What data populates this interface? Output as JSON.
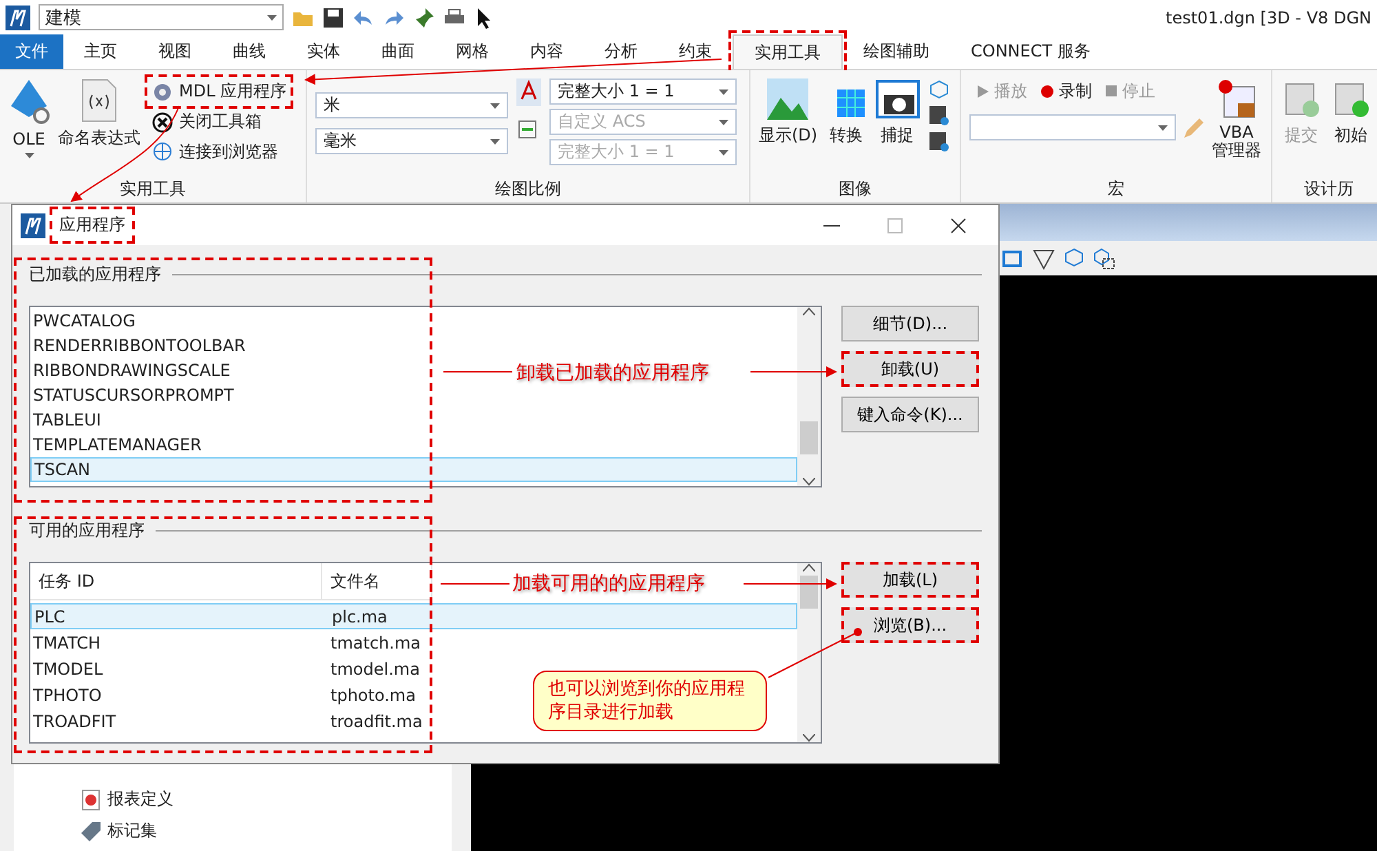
{
  "app": {
    "workflow": "建模",
    "title": "test01.dgn [3D - V8 DGN"
  },
  "menu_tabs": [
    {
      "label": "文件",
      "kind": "file",
      "selected": false,
      "highlighted": false
    },
    {
      "label": "主页",
      "kind": "tab",
      "selected": false,
      "highlighted": false
    },
    {
      "label": "视图",
      "kind": "tab",
      "selected": false,
      "highlighted": false
    },
    {
      "label": "曲线",
      "kind": "tab",
      "selected": false,
      "highlighted": false
    },
    {
      "label": "实体",
      "kind": "tab",
      "selected": false,
      "highlighted": false
    },
    {
      "label": "曲面",
      "kind": "tab",
      "selected": false,
      "highlighted": false
    },
    {
      "label": "网格",
      "kind": "tab",
      "selected": false,
      "highlighted": false
    },
    {
      "label": "内容",
      "kind": "tab",
      "selected": false,
      "highlighted": false
    },
    {
      "label": "分析",
      "kind": "tab",
      "selected": false,
      "highlighted": false
    },
    {
      "label": "约束",
      "kind": "tab",
      "selected": false,
      "highlighted": false
    },
    {
      "label": "实用工具",
      "kind": "tab",
      "selected": true,
      "highlighted": true
    },
    {
      "label": "绘图辅助",
      "kind": "tab",
      "selected": false,
      "highlighted": false
    },
    {
      "label": "CONNECT 服务",
      "kind": "tab",
      "selected": false,
      "highlighted": false
    }
  ],
  "ribbon": {
    "utility": {
      "label": "实用工具",
      "large": [
        "OLE",
        "命名表达式"
      ],
      "small": [
        {
          "label": "MDL 应用程序",
          "highlighted": true
        },
        {
          "label": "关闭工具箱",
          "highlighted": false
        },
        {
          "label": "连接到浏览器",
          "highlighted": false
        }
      ]
    },
    "scale": {
      "label": "绘图比例",
      "units": [
        "米",
        "毫米"
      ],
      "scales": [
        {
          "value": "完整大小 1 = 1",
          "disabled": false
        },
        {
          "value": "自定义 ACS",
          "disabled": true
        },
        {
          "value": "完整大小 1 = 1",
          "disabled": true
        }
      ]
    },
    "image": {
      "label": "图像",
      "buttons": [
        "显示(D)",
        "转换",
        "捕捉"
      ]
    },
    "macro": {
      "label": "宏",
      "controls": [
        {
          "label": "播放",
          "kind": "play",
          "disabled": true
        },
        {
          "label": "录制",
          "kind": "record",
          "disabled": false
        },
        {
          "label": "停止",
          "kind": "stop",
          "disabled": true
        }
      ],
      "vba": [
        "VBA",
        "管理器"
      ]
    },
    "history": {
      "label": "设计历",
      "buttons": [
        {
          "label": "提交",
          "disabled": true
        },
        {
          "label": "初始",
          "disabled": false
        }
      ]
    }
  },
  "dialog": {
    "title": "应用程序",
    "loaded": {
      "legend": "已加载的应用程序",
      "items": [
        {
          "name": "PWCATALOG",
          "selected": false
        },
        {
          "name": "RENDERRIBBONTOOLBAR",
          "selected": false
        },
        {
          "name": "RIBBONDRAWINGSCALE",
          "selected": false
        },
        {
          "name": "STATUSCURSORPROMPT",
          "selected": false
        },
        {
          "name": "TABLEUI",
          "selected": false
        },
        {
          "name": "TEMPLATEMANAGER",
          "selected": false
        },
        {
          "name": "TSCAN",
          "selected": true
        }
      ],
      "buttons": [
        {
          "label": "细节(D)...",
          "highlighted": false
        },
        {
          "label": "卸载(U)",
          "highlighted": true
        },
        {
          "label": "键入命令(K)...",
          "highlighted": false
        }
      ]
    },
    "available": {
      "legend": "可用的应用程序",
      "columns": [
        "任务 ID",
        "文件名"
      ],
      "rows": [
        {
          "id": "PLC",
          "file": "plc.ma",
          "selected": true
        },
        {
          "id": "TMATCH",
          "file": "tmatch.ma",
          "selected": false
        },
        {
          "id": "TMODEL",
          "file": "tmodel.ma",
          "selected": false
        },
        {
          "id": "TPHOTO",
          "file": "tphoto.ma",
          "selected": false
        },
        {
          "id": "TROADFIT",
          "file": "troadfit.ma",
          "selected": false
        }
      ],
      "buttons": [
        {
          "label": "加载(L)",
          "highlighted": true
        },
        {
          "label": "浏览(B)...",
          "highlighted": true
        }
      ]
    }
  },
  "annotations": {
    "unload": "卸载已加载的应用程序",
    "load": "加载可用的的应用程序",
    "browse": "也可以浏览到你的应用程序目录进行加载"
  },
  "side_panel": {
    "items": [
      "报表定义",
      "标记集"
    ]
  }
}
